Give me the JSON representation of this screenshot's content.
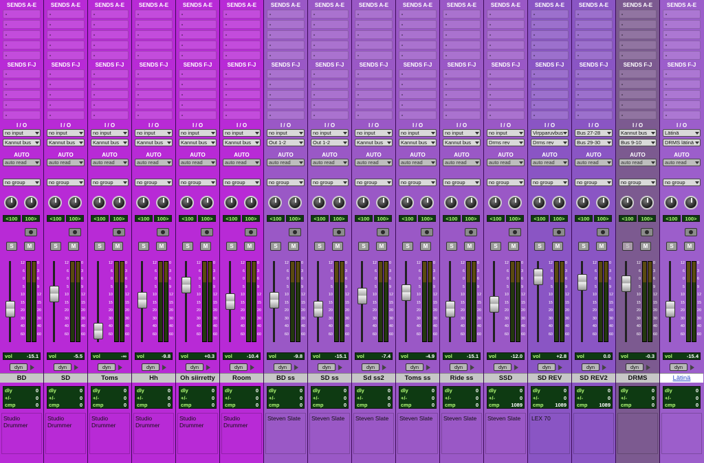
{
  "labels": {
    "sends_ae": "SENDS A-E",
    "sends_fj": "SENDS F-J",
    "io": "I / O",
    "auto": "AUTO",
    "solo": "S",
    "mute": "M",
    "vol": "vol",
    "dyn": "dyn",
    "dly": "dly",
    "plusminus": "+/-",
    "cmp": "cmp"
  },
  "scale_left": [
    "12",
    "6",
    "0",
    "5",
    "10",
    "15",
    "20",
    "30",
    "40",
    "60"
  ],
  "scale_right": [
    "0",
    "3",
    "6",
    "9",
    "12",
    "15",
    "20",
    "30",
    "40",
    "60"
  ],
  "colors": {
    "strip_magenta": "#a81ec9",
    "strip_purple": "#8a45b8",
    "strip_violet": "#7b3fa8",
    "strip_grey": "#7a5a8a"
  },
  "channels": [
    {
      "name": "BD",
      "input": "no input",
      "output": "Kannut bus",
      "auto": "auto read",
      "group": "no group",
      "pan_l": "<100",
      "pan_r": "100>",
      "vol": "-15.1",
      "dly": "0",
      "pm": "0",
      "cmp": "0",
      "comment": "Studio Drummer",
      "color": "#b82ad6",
      "fader_level": 0.62
    },
    {
      "name": "SD",
      "input": "no input",
      "output": "Kannut bus",
      "auto": "auto read",
      "group": "no group",
      "pan_l": "<100",
      "pan_r": "100>",
      "vol": "-5.5",
      "dly": "0",
      "pm": "0",
      "cmp": "0",
      "comment": "Studio Drummer",
      "color": "#b82ad6",
      "fader_level": 0.38
    },
    {
      "name": "Toms",
      "input": "no input",
      "output": "Kannut bus",
      "auto": "auto read",
      "group": "no group",
      "pan_l": "<100",
      "pan_r": "100>",
      "vol": "-∞",
      "dly": "0",
      "pm": "0",
      "cmp": "0",
      "comment": "Studio Drummer",
      "color": "#b82ad6",
      "fader_level": 0.96
    },
    {
      "name": "Hh",
      "input": "no input",
      "output": "Kannut bus",
      "auto": "auto read",
      "group": "no group",
      "pan_l": "<100",
      "pan_r": "100>",
      "vol": "-9.8",
      "dly": "0",
      "pm": "0",
      "cmp": "0",
      "comment": "Studio Drummer",
      "color": "#b82ad6",
      "fader_level": 0.48
    },
    {
      "name": "Oh siirretty",
      "input": "no input",
      "output": "Kannut bus",
      "auto": "auto read",
      "group": "no group",
      "pan_l": "<100",
      "pan_r": "100>",
      "vol": "+0.3",
      "dly": "0",
      "pm": "0",
      "cmp": "0",
      "comment": "Studio Drummer",
      "color": "#b82ad6",
      "fader_level": 0.24
    },
    {
      "name": "Room",
      "input": "no input",
      "output": "Kannut bus",
      "auto": "auto read",
      "group": "no group",
      "pan_l": "<100",
      "pan_r": "100>",
      "vol": "-10.4",
      "dly": "0",
      "pm": "0",
      "cmp": "0",
      "comment": "Studio Drummer",
      "color": "#b82ad6",
      "fader_level": 0.5
    },
    {
      "name": "BD ss",
      "input": "no input",
      "output": "Out 1-2",
      "auto": "auto read",
      "group": "no group",
      "pan_l": "<100",
      "pan_r": "100>",
      "vol": "-9.8",
      "dly": "0",
      "pm": "0",
      "cmp": "0",
      "comment": "Steven Slate",
      "color": "#9a58c6",
      "fader_level": 0.48
    },
    {
      "name": "SD ss",
      "input": "no input",
      "output": "Out 1-2",
      "auto": "auto read",
      "group": "no group",
      "pan_l": "<100",
      "pan_r": "100>",
      "vol": "-15.1",
      "dly": "0",
      "pm": "0",
      "cmp": "0",
      "comment": "Steven Slate",
      "color": "#9a58c6",
      "fader_level": 0.62
    },
    {
      "name": "Sd ss2",
      "input": "no input",
      "output": "Kannut bus",
      "auto": "auto read",
      "group": "no group",
      "pan_l": "<100",
      "pan_r": "100>",
      "vol": "-7.4",
      "dly": "0",
      "pm": "0",
      "cmp": "0",
      "comment": "Steven Slate",
      "color": "#9a58c6",
      "fader_level": 0.42
    },
    {
      "name": "Toms ss",
      "input": "no input",
      "output": "Kannut bus",
      "auto": "auto read",
      "group": "no group",
      "pan_l": "<100",
      "pan_r": "100>",
      "vol": "-4.9",
      "dly": "0",
      "pm": "0",
      "cmp": "0",
      "comment": "Steven Slate",
      "color": "#9a58c6",
      "fader_level": 0.36
    },
    {
      "name": "Ride ss",
      "input": "no input",
      "output": "Kannut bus",
      "auto": "auto read",
      "group": "no group",
      "pan_l": "<100",
      "pan_r": "100>",
      "vol": "-15.1",
      "dly": "0",
      "pm": "0",
      "cmp": "0",
      "comment": "Steven Slate",
      "color": "#9a58c6",
      "fader_level": 0.62,
      "clip": true
    },
    {
      "name": "SSD",
      "input": "no input",
      "output": "Drms rev",
      "auto": "auto read",
      "group": "no group",
      "pan_l": "<100",
      "pan_r": "100>",
      "vol": "-12.0",
      "dly": "0",
      "pm": "0",
      "cmp": "1089",
      "comment": "Steven Slate",
      "color": "#9a58c6",
      "fader_level": 0.54
    },
    {
      "name": "SD REV",
      "input": "Virpparuvbus",
      "output": "Drms rev",
      "auto": "auto read",
      "group": "no group",
      "pan_l": "<100",
      "pan_r": "100>",
      "vol": "+2.8",
      "dly": "0",
      "pm": "0",
      "cmp": "1089",
      "comment": "LEX 70",
      "color": "#8a55c4",
      "fader_level": 0.12
    },
    {
      "name": "SD REV2",
      "input": "Bus 27-28",
      "output": "Bus 29-30",
      "auto": "auto read",
      "group": "no group",
      "pan_l": "<100",
      "pan_r": "100>",
      "vol": "0.0",
      "dly": "0",
      "pm": "0",
      "cmp": "1089",
      "comment": "",
      "color": "#8a55c4",
      "fader_level": 0.2
    },
    {
      "name": "DRMS",
      "input": "Kannut bus",
      "output": "Bus 9-10",
      "auto": "auto read",
      "group": "no group",
      "pan_l": "<100",
      "pan_r": "100>",
      "vol": "-0.3",
      "dly": "0",
      "pm": "0",
      "cmp": "0",
      "comment": "",
      "color": "#7c5a90",
      "fader_level": 0.22,
      "dim_solo": true
    },
    {
      "name": "Lätinä",
      "input": "Lätinä",
      "output": "DRMS lätinä",
      "auto": "auto read",
      "group": "no group",
      "pan_l": "<100",
      "pan_r": "100>",
      "vol": "-15.4",
      "dly": "0",
      "pm": "0",
      "cmp": "0",
      "comment": "",
      "color": "#9c5ecb",
      "fader_level": 0.62,
      "selected": true
    }
  ]
}
